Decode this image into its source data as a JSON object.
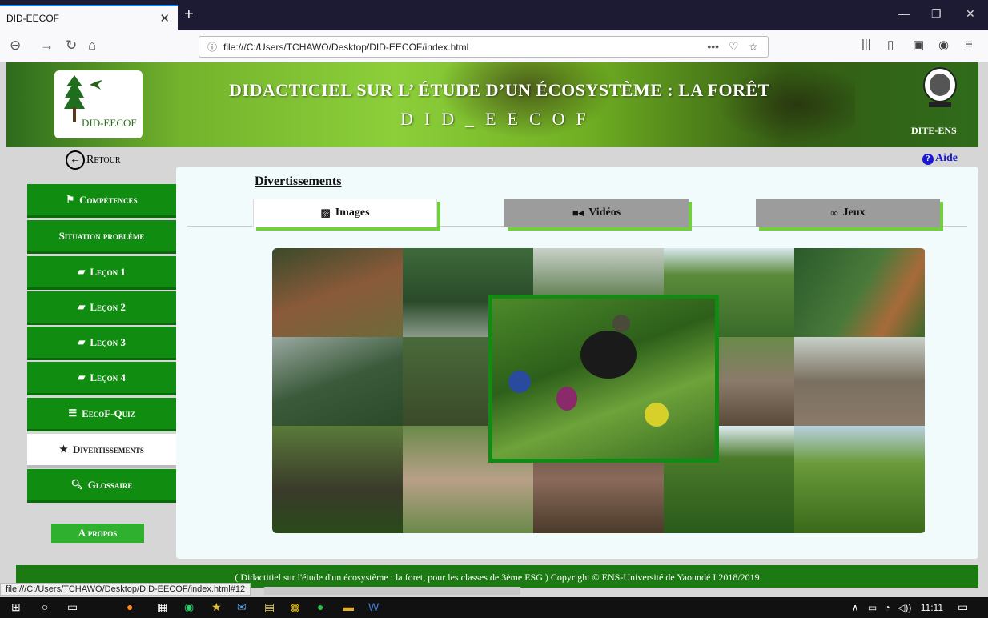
{
  "browser": {
    "tab_title": "DID-EECOF",
    "url": "file:///C:/Users/TCHAWO/Desktop/DID-EECOF/index.html",
    "status_url": "file:///C:/Users/TCHAWO/Desktop/DID-EECOF/index.html#12",
    "url_dots": "•••"
  },
  "banner": {
    "logo_text": "DID-EECOF",
    "title": "DIDACTICIEL SUR L’ ÉTUDE D’UN ÉCOSYSTÈME : LA FORÊT",
    "subtitle": "DID_EECOF",
    "seal_text": "DITE-ENS"
  },
  "nav": {
    "back_label": "Retour",
    "help_label": "Aide"
  },
  "sidebar": {
    "items": [
      {
        "label": "Compétences",
        "icon": "flag-icon"
      },
      {
        "label": "Situation problème",
        "icon": ""
      },
      {
        "label": "Leçon 1",
        "icon": "book-icon"
      },
      {
        "label": "Leçon 2",
        "icon": "book-icon"
      },
      {
        "label": "Leçon 3",
        "icon": "book-icon"
      },
      {
        "label": "Leçon 4",
        "icon": "book-icon"
      },
      {
        "label": "EecoF-Quiz",
        "icon": "list-icon"
      },
      {
        "label": "Divertissements",
        "icon": "star-icon",
        "active": true
      },
      {
        "label": "Glossaire",
        "icon": "search-icon"
      }
    ],
    "apropos": "A propos"
  },
  "main": {
    "section_title": "Divertissements",
    "tabs": [
      {
        "label": "Images",
        "icon": "image-icon",
        "active": true
      },
      {
        "label": "Vidéos",
        "icon": "video-icon"
      },
      {
        "label": "Jeux",
        "icon": "gamepad-icon"
      }
    ]
  },
  "footer": {
    "text": "( Didactitiel sur l'étude d'un écosystème : la foret, pour les classes de 3ème ESG ) Copyright © ENS-Université de Yaoundé I 2018/2019"
  },
  "taskbar": {
    "time": "11:11"
  },
  "colors": {
    "sidebar_green": "#108c10",
    "tab_shadow_green": "#72d03e",
    "footer_green": "#1c7a12",
    "help_blue": "#1a1acc"
  }
}
